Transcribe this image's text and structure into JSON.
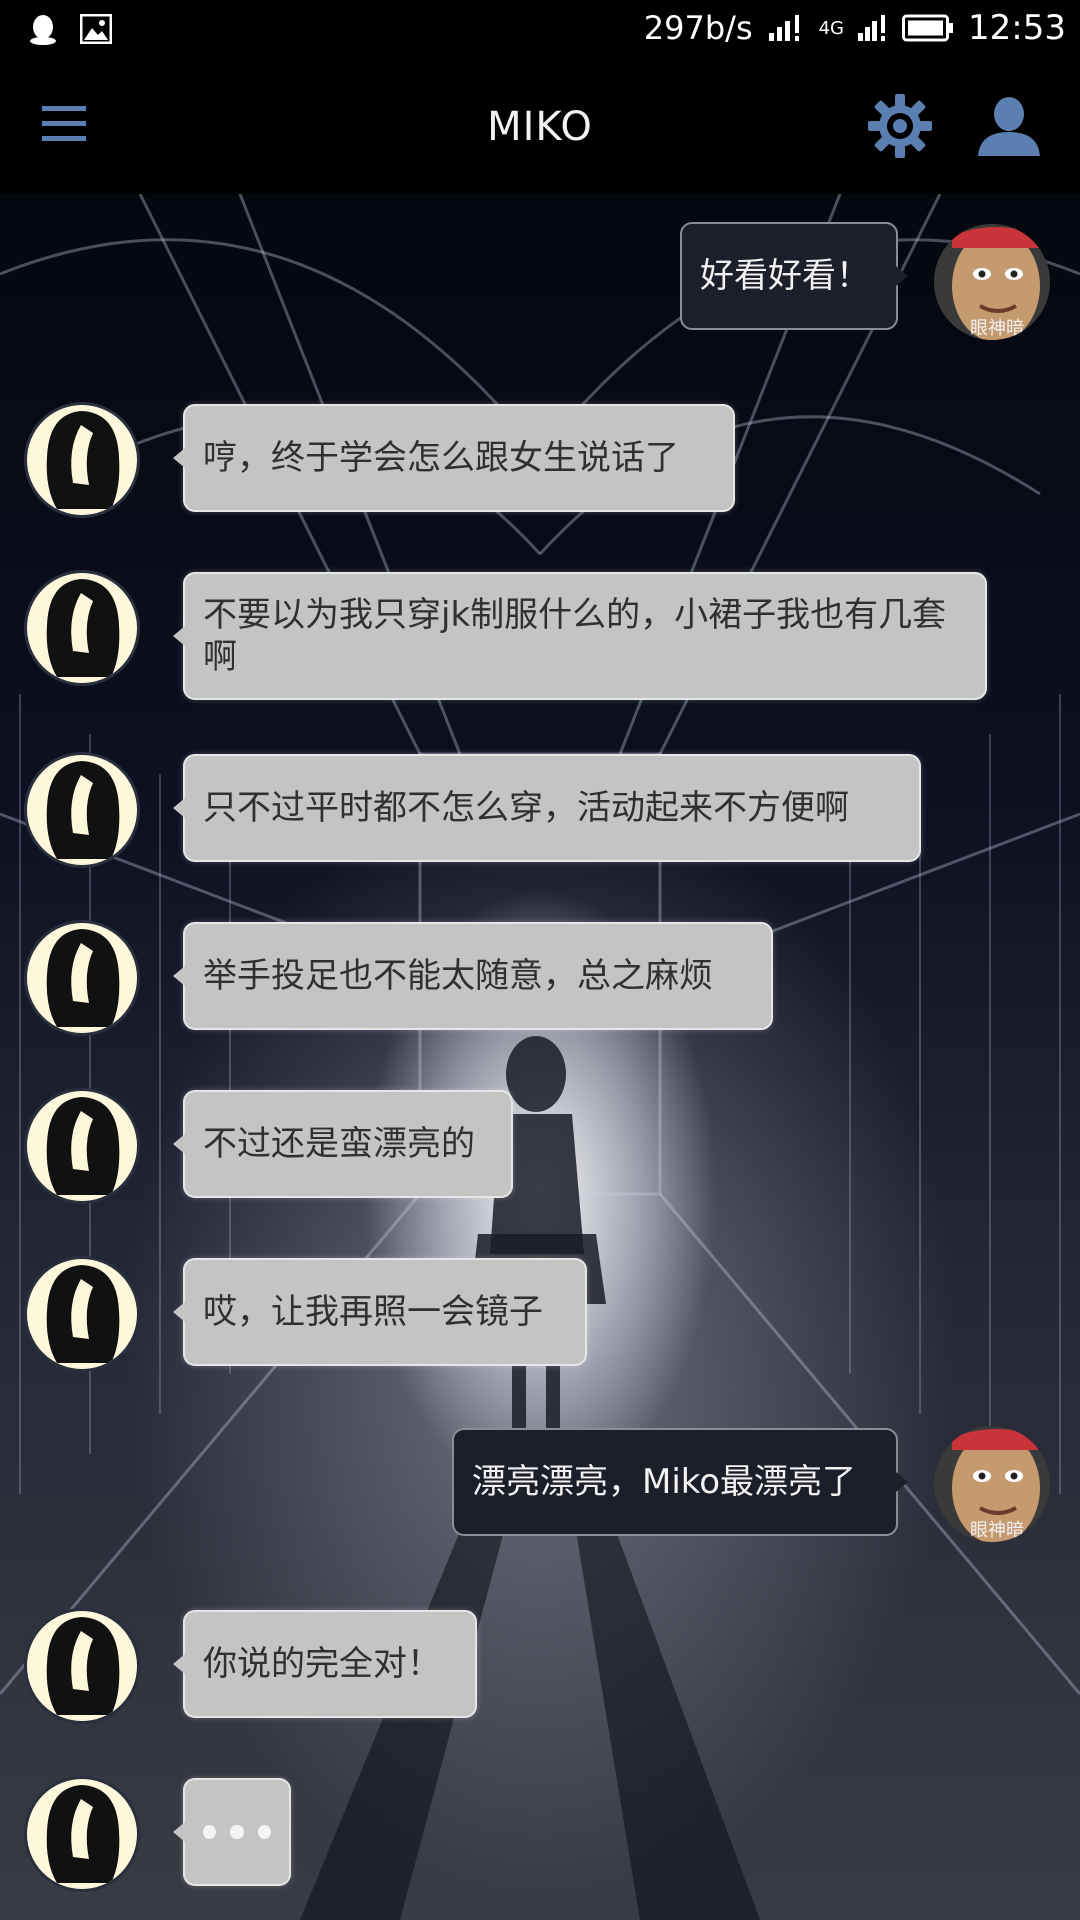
{
  "status_bar": {
    "left_icons": [
      "qq-icon",
      "image-icon"
    ],
    "network_speed": "297b/s",
    "network_type": "4G",
    "time": "12:53"
  },
  "app_bar": {
    "title": "MIKO",
    "icons": [
      "menu-icon",
      "gear-icon",
      "user-profile-icon"
    ]
  },
  "user_avatar_caption": "眼神暗",
  "messages": [
    {
      "sender": "user",
      "text": "好看好看！"
    },
    {
      "sender": "miko",
      "text": "哼，终于学会怎么跟女生说话了"
    },
    {
      "sender": "miko",
      "text": "不要以为我只穿jk制服什么的，小裙子我也有几套啊"
    },
    {
      "sender": "miko",
      "text": "只不过平时都不怎么穿，活动起来不方便啊"
    },
    {
      "sender": "miko",
      "text": "举手投足也不能太随意，总之麻烦"
    },
    {
      "sender": "miko",
      "text": "不过还是蛮漂亮的"
    },
    {
      "sender": "miko",
      "text": "哎，让我再照一会镜子"
    },
    {
      "sender": "user",
      "text": "漂亮漂亮，Miko最漂亮了"
    },
    {
      "sender": "miko",
      "text": "你说的完全对！"
    },
    {
      "sender": "miko",
      "typing": true,
      "text": ""
    }
  ],
  "colors": {
    "icon_accent": "#5b7fb0",
    "bot_bubble": "#c4c4c4",
    "user_bubble": "#1c1f29",
    "bot_avatar_bg": "#fdf7dc"
  }
}
